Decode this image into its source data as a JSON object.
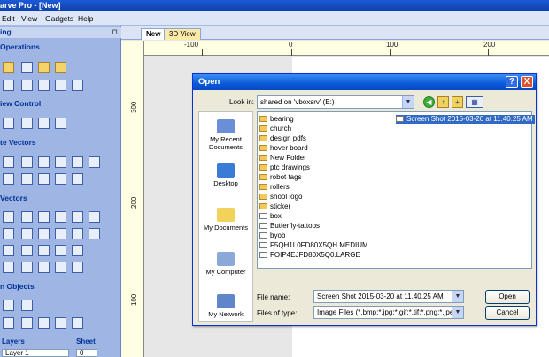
{
  "app": {
    "title": "arve Pro - [New]"
  },
  "menu": [
    "Edit",
    "View",
    "Gadgets",
    "Help"
  ],
  "left_panel": {
    "header_fragment": "ing",
    "pin": "⊓",
    "sections": [
      "Operations",
      "iew Control",
      "te Vectors",
      "Vectors",
      "n Objects"
    ],
    "bottom_labels": [
      "Layers",
      "Sheet"
    ],
    "layer_value": "Layer 1",
    "sheet_value": "0"
  },
  "tabs": [
    "New",
    "3D View"
  ],
  "ruler": {
    "top": [
      "-100",
      "0",
      "100",
      "200"
    ],
    "left": [
      "300",
      "200",
      "100"
    ]
  },
  "dialog": {
    "title": "Open",
    "look_in_label": "Look in:",
    "look_in_value": "shared on 'vboxsrv' (E:)",
    "places": [
      "My Recent Documents",
      "Desktop",
      "My Documents",
      "My Computer",
      "My Network"
    ],
    "files": [
      {
        "name": "bearing",
        "kind": "folder"
      },
      {
        "name": "church",
        "kind": "folder"
      },
      {
        "name": "design pdfs",
        "kind": "folder"
      },
      {
        "name": "hover board",
        "kind": "folder"
      },
      {
        "name": "New Folder",
        "kind": "folder"
      },
      {
        "name": "ptc drawings",
        "kind": "folder"
      },
      {
        "name": "robot tags",
        "kind": "folder"
      },
      {
        "name": "rollers",
        "kind": "folder"
      },
      {
        "name": "shool logo",
        "kind": "folder"
      },
      {
        "name": "sticker",
        "kind": "folder"
      },
      {
        "name": "box",
        "kind": "file"
      },
      {
        "name": "Butterfly-tattoos",
        "kind": "file"
      },
      {
        "name": "byob",
        "kind": "file"
      },
      {
        "name": "F5QH1L0FD80X5QH.MEDIUM",
        "kind": "file"
      },
      {
        "name": "FOIP4EJFD80X5Q0.LARGE",
        "kind": "file"
      },
      {
        "name": "Screen Shot 2015-03-20 at 11.40.25 AM",
        "kind": "file"
      }
    ],
    "file_name_label": "File name:",
    "file_name_value": "Screen Shot 2015-03-20 at 11.40.25 AM",
    "file_type_label": "Files of type:",
    "file_type_value": "Image Files (*.bmp;*.jpg;*.gif;*.tif;*.png;*.jpeg)",
    "open_label": "Open",
    "cancel_label": "Cancel",
    "help_glyph": "?",
    "close_glyph": "X"
  }
}
